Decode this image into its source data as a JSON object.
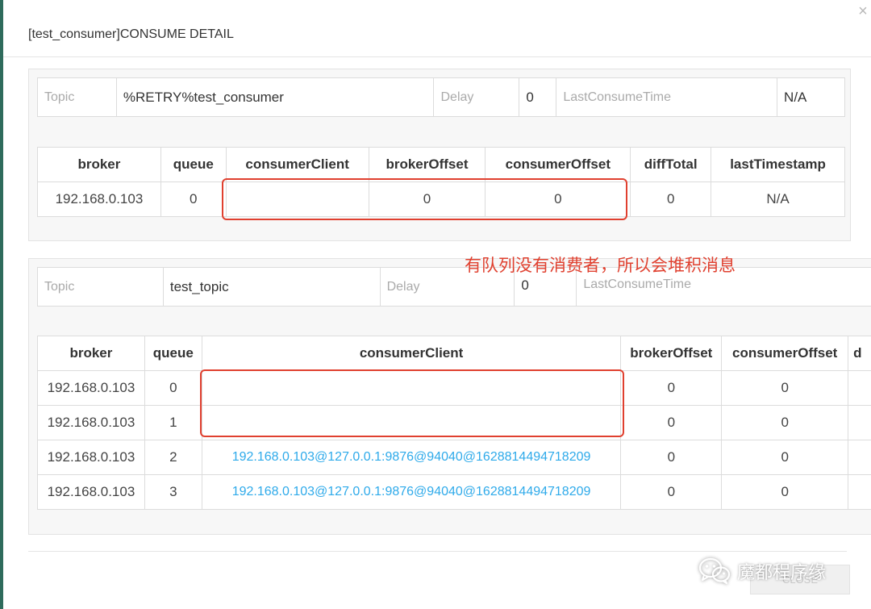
{
  "modal": {
    "title": "[test_consumer]CONSUME DETAIL",
    "close_label": "CLOSE"
  },
  "section1": {
    "info": {
      "topic_label": "Topic",
      "topic_value": "%RETRY%test_consumer",
      "delay_label": "Delay",
      "delay_value": "0",
      "lastconsume_label": "LastConsumeTime",
      "lastconsume_value": "N/A"
    },
    "columns": [
      "broker",
      "queue",
      "consumerClient",
      "brokerOffset",
      "consumerOffset",
      "diffTotal",
      "lastTimestamp"
    ],
    "rows": [
      [
        "192.168.0.103",
        "0",
        "",
        "0",
        "0",
        "0",
        "N/A"
      ]
    ]
  },
  "section2": {
    "info": {
      "topic_label": "Topic",
      "topic_value": "test_topic",
      "delay_label": "Delay",
      "delay_value": "0",
      "lastconsume_label": "LastConsumeTime"
    },
    "columns": [
      "broker",
      "queue",
      "consumerClient",
      "brokerOffset",
      "consumerOffset",
      "d"
    ],
    "rows": [
      [
        "192.168.0.103",
        "0",
        "",
        "0",
        "0"
      ],
      [
        "192.168.0.103",
        "1",
        "",
        "0",
        "0"
      ],
      [
        "192.168.0.103",
        "2",
        "192.168.0.103@127.0.0.1:9876@94040@1628814494718209",
        "0",
        "0"
      ],
      [
        "192.168.0.103",
        "3",
        "192.168.0.103@127.0.0.1:9876@94040@1628814494718209",
        "0",
        "0"
      ]
    ]
  },
  "annotation": {
    "text": "有队列没有消费者，所以会堆积消息"
  },
  "watermark": {
    "text": "魔都程序缘",
    "icon": "wechat-icon"
  },
  "colors": {
    "annotation": "#e0402f",
    "link": "#2eaaea",
    "backdrop_accent": "#2f6b5c"
  }
}
